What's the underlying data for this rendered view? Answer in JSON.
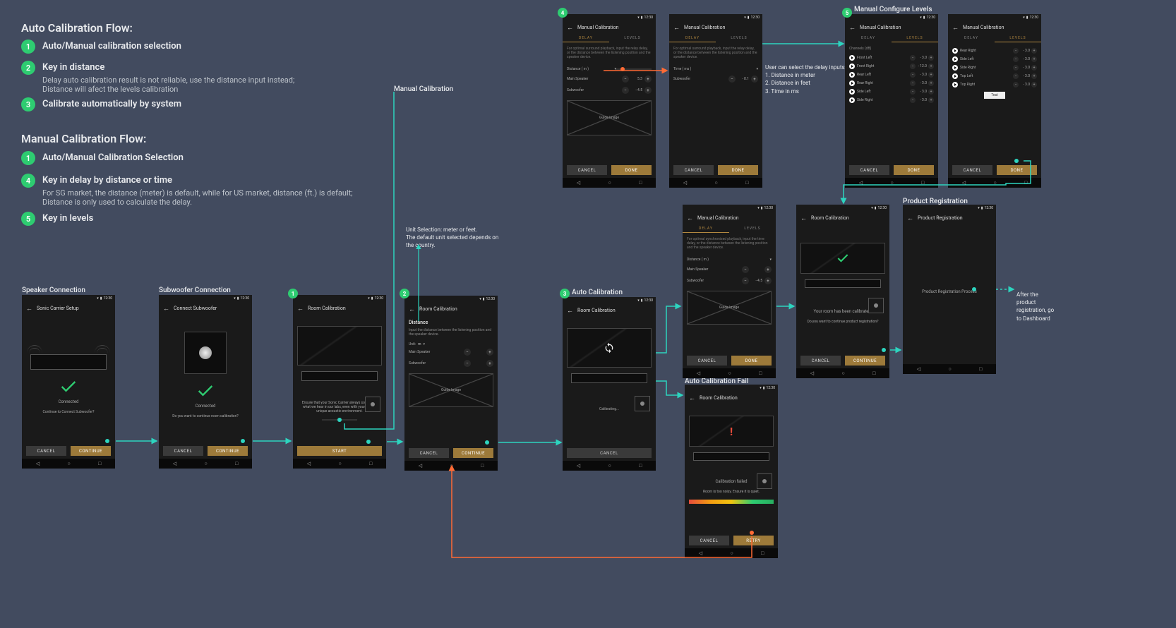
{
  "autoFlow": {
    "title": "Auto Calibration Flow:",
    "steps": [
      {
        "num": "1",
        "title": "Auto/Manual calibration selection",
        "sub": ""
      },
      {
        "num": "2",
        "title": "Key in distance",
        "sub": "Delay auto calibration result is not reliable, use the distance input instead;\nDistance will afect the levels calibration"
      },
      {
        "num": "3",
        "title": "Calibrate automatically by system",
        "sub": ""
      }
    ]
  },
  "manualFlow": {
    "title": "Manual Calibration Flow:",
    "steps": [
      {
        "num": "1",
        "title": "Auto/Manual Calibration Selection",
        "sub": ""
      },
      {
        "num": "4",
        "title": "Key in delay by distance or time",
        "sub": "For SG market, the distance (meter) is default, while for US market, distance (ft.) is default;\nDistance is only used to calculate the delay."
      },
      {
        "num": "5",
        "title": "Key in levels",
        "sub": ""
      }
    ]
  },
  "labels": {
    "speakerConnection": "Speaker Connection",
    "subwooferConnection": "Subwoofer Connection",
    "manualCalibration": "Manual Calibration",
    "autoCalibration": "Auto Calibration",
    "autoCalibrationFail": "Auto Calibration Fail",
    "manualConfigureLevels": "Manual Configure Levels",
    "productRegistration": "Product Registration"
  },
  "annotations": {
    "unitSelection": "Unit Selection: meter or feet.\nThe default unit selected depends on\nthe country.",
    "delayInputs": "User can select the delay inputs:\n1. Distance in meter\n2. Distance in feet\n3. Time in ms",
    "afterReg": "After the product registration, go to Dashboard"
  },
  "common": {
    "time": "12:30",
    "cancel": "CANCEL",
    "continue": "CONTINUE",
    "done": "DONE",
    "start": "START",
    "retry": "RETRY",
    "test": "Test",
    "guideImage": "Guide Image",
    "delay": "DELAY",
    "levels": "LEVELS"
  },
  "phones": {
    "speaker": {
      "title": "Sonic Carrier Setup",
      "connected": "Connected",
      "question": "Continue to Connect Subwoofer?"
    },
    "subwoofer": {
      "title": "Connect Subwoofer",
      "connected": "Connected",
      "question": "Do you want to continue room calibration?"
    },
    "roomCal1": {
      "title": "Room Calibration",
      "desc": "Ensure that your Sonic Carrier always sound like what we hear in our labs, even with your room's unique acoustic environment."
    },
    "roomCal2": {
      "title": "Room Calibration",
      "header": "Distance",
      "desc": "Input the distance between the listening position and the speaker device.",
      "unitPrefix": "Unit:",
      "unit": "m",
      "mainSpeaker": "Main Speaker",
      "subwoofer": "Subwoofer"
    },
    "autoCal": {
      "title": "Room Calibration",
      "calibrating": "Calibrating..."
    },
    "manualCal4a": {
      "title": "Manual Calibration",
      "desc": "For optimal surround playback, input the relay delay, or the distance between the listening position and the speaker device.",
      "distance": "Distance ( m )",
      "mainSpeaker": "Main Speaker",
      "mainVal": "5.3",
      "subwoofer": "Subwoofer",
      "subVal": "- 4.5"
    },
    "manualCal4b": {
      "title": "Manual Calibration",
      "desc": "For optimal surround playback, input the relay delay, or the distance between the listening position and the speaker device.",
      "time": "Time ( ms )",
      "subwoofer": "Subwoofer",
      "subVal": "- 0.1"
    },
    "manualCal5a": {
      "title": "Manual Calibration",
      "channelsHdr": "Channels (dB)",
      "rows": [
        {
          "name": "Front Left",
          "val": "- 3.0"
        },
        {
          "name": "Front Right",
          "val": "- 12.0"
        },
        {
          "name": "Rear Left",
          "val": "- 3.0"
        },
        {
          "name": "Rear Right",
          "val": "- 3.0"
        },
        {
          "name": "Side Left",
          "val": "- 3.0"
        },
        {
          "name": "Side Right",
          "val": "- 3.0"
        }
      ]
    },
    "manualCal5b": {
      "title": "Manual Calibration",
      "rows": [
        {
          "name": "Rear Right",
          "val": "- 3.0"
        },
        {
          "name": "Side Left",
          "val": "- 3.0"
        },
        {
          "name": "Side Right",
          "val": "- 3.0"
        },
        {
          "name": "Top Left",
          "val": "- 3.0"
        },
        {
          "name": "Top Right",
          "val": "- 3.0"
        }
      ]
    },
    "manualCalContinue": {
      "title": "Manual Calibration",
      "desc": "For optimal synchronized playback, input the time delay, or the distance between the listening position and the speaker device.",
      "distance": "Distance ( m )",
      "mainSpeaker": "Main Speaker",
      "subwoofer": "Subwoofer",
      "subVal": "- 4.5"
    },
    "roomCalDone": {
      "title": "Room Calibration",
      "done": "Your room has been calibrated.",
      "question": "Do you want to continue product registration?"
    },
    "roomCalFail": {
      "title": "Room Calibration",
      "failed": "Calibration failed",
      "reason": "Room is too noisy. Ensure it is quiet."
    },
    "productReg": {
      "title": "Product Registration",
      "line": "Product Registration Process"
    }
  }
}
